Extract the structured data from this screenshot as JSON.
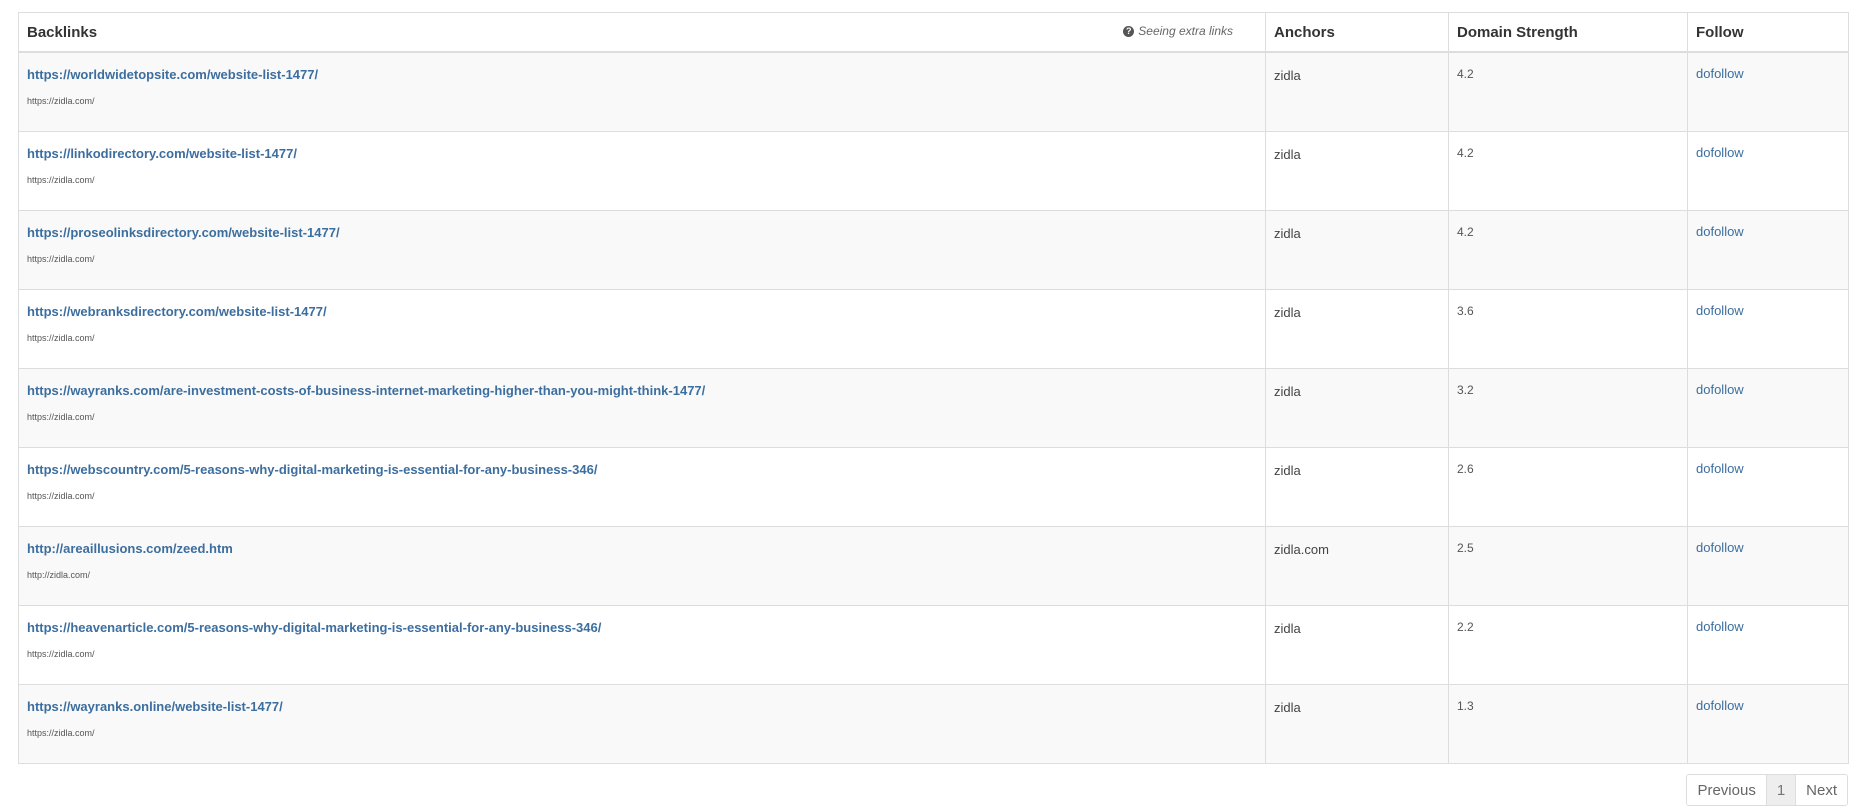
{
  "table": {
    "headers": {
      "backlinks": "Backlinks",
      "seeing_extra": "Seeing extra links",
      "anchors": "Anchors",
      "domain_strength": "Domain Strength",
      "follow": "Follow"
    },
    "rows": [
      {
        "url": "https://worldwidetopsite.com/website-list-1477/",
        "target": "https://zidla.com/",
        "anchor": "zidla",
        "strength": "4.2",
        "follow": "dofollow"
      },
      {
        "url": "https://linkodirectory.com/website-list-1477/",
        "target": "https://zidla.com/",
        "anchor": "zidla",
        "strength": "4.2",
        "follow": "dofollow"
      },
      {
        "url": "https://proseolinksdirectory.com/website-list-1477/",
        "target": "https://zidla.com/",
        "anchor": "zidla",
        "strength": "4.2",
        "follow": "dofollow"
      },
      {
        "url": "https://webranksdirectory.com/website-list-1477/",
        "target": "https://zidla.com/",
        "anchor": "zidla",
        "strength": "3.6",
        "follow": "dofollow"
      },
      {
        "url": "https://wayranks.com/are-investment-costs-of-business-internet-marketing-higher-than-you-might-think-1477/",
        "target": "https://zidla.com/",
        "anchor": "zidla",
        "strength": "3.2",
        "follow": "dofollow"
      },
      {
        "url": "https://webscountry.com/5-reasons-why-digital-marketing-is-essential-for-any-business-346/",
        "target": "https://zidla.com/",
        "anchor": "zidla",
        "strength": "2.6",
        "follow": "dofollow"
      },
      {
        "url": "http://areaillusions.com/zeed.htm",
        "target": "http://zidla.com/",
        "anchor": "zidla.com",
        "strength": "2.5",
        "follow": "dofollow"
      },
      {
        "url": "https://heavenarticle.com/5-reasons-why-digital-marketing-is-essential-for-any-business-346/",
        "target": "https://zidla.com/",
        "anchor": "zidla",
        "strength": "2.2",
        "follow": "dofollow"
      },
      {
        "url": "https://wayranks.online/website-list-1477/",
        "target": "https://zidla.com/",
        "anchor": "zidla",
        "strength": "1.3",
        "follow": "dofollow"
      }
    ]
  },
  "pagination": {
    "previous": "Previous",
    "current_page": "1",
    "next": "Next"
  },
  "colors": {
    "link": "#3c6e9f",
    "border": "#dddddd",
    "stripe": "#f9f9f9"
  }
}
